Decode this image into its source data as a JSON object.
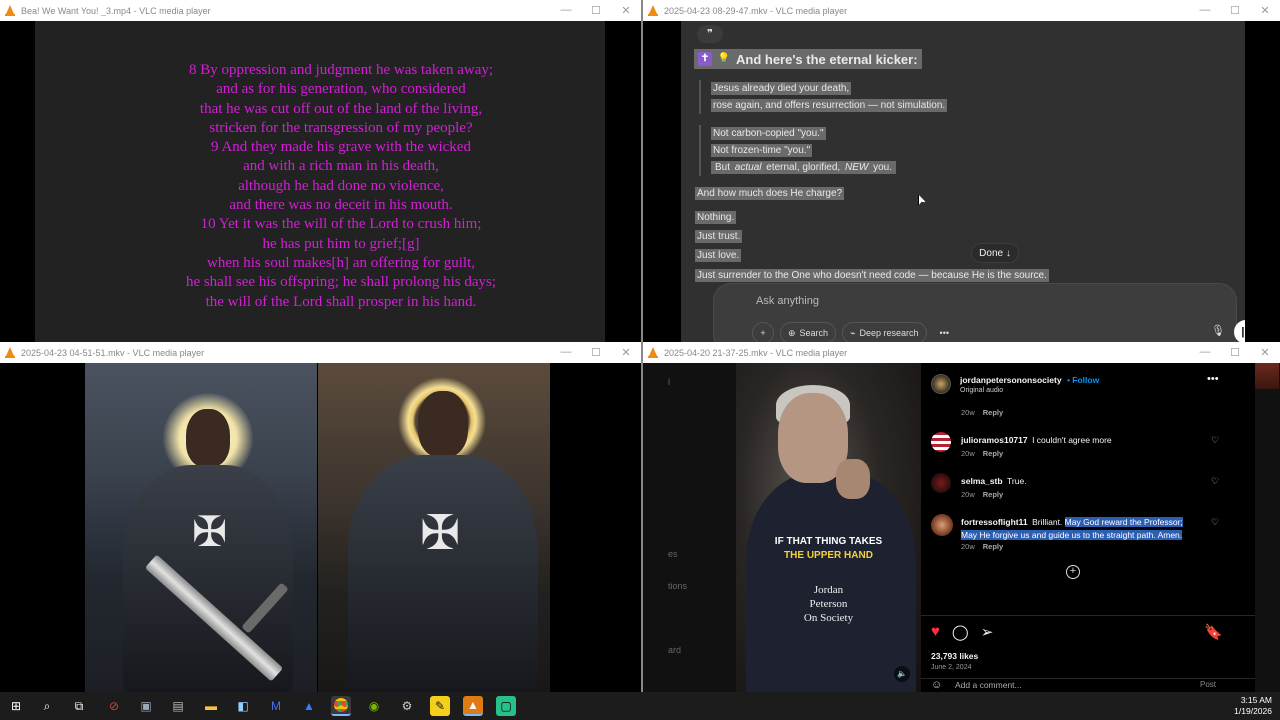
{
  "windows": {
    "w1": {
      "title": "Bea! We Want You! _3.mp4 - VLC media player",
      "verses": [
        "8 By oppression and judgment he was taken away;",
        "and as for his generation, who considered",
        "that he was cut off out of the land of the living,",
        "stricken for the transgression of my people?",
        "9 And they made his grave with the wicked",
        "and with a rich man in his death,",
        "although he had done no violence,",
        "and there was no deceit in his mouth.",
        "10 Yet it was the will of the Lord to crush him;",
        "he has put him to grief;[g]",
        "when his soul makes[h] an offering for guilt,",
        "he shall see his offspring; he shall prolong his days;",
        "the will of the Lord shall prosper in his hand."
      ]
    },
    "w2": {
      "title": "2025-04-23 08-29-47.mkv - VLC media player",
      "quote_icon": "❞",
      "heading": "And here's the eternal kicker:",
      "block1": [
        "Jesus already died your death,",
        "rose again, and offers resurrection — not simulation."
      ],
      "block2_line1": "Not carbon-copied \"you.\"",
      "block2_line2": "Not frozen-time \"you.\"",
      "block2_line3_pre": "But ",
      "block2_line3_em1": "actual",
      "block2_line3_mid": " eternal, glorified, ",
      "block2_line3_em2": "NEW",
      "block2_line3_post": " you.",
      "question": "And how much does He charge?",
      "answers": [
        "Nothing.",
        "Just trust.",
        "Just love.",
        "Just surrender to the One who doesn't need code — because He is the source."
      ],
      "done_label": "Done ↓",
      "composer_placeholder": "Ask anything",
      "tool_search": "Search",
      "tool_deep": "Deep research"
    },
    "w3": {
      "title": "2025-04-23 04-51-51.mkv - VLC media player"
    },
    "w4": {
      "title": "2025-04-20 21-37-25.mkv - VLC media player",
      "left_fragments": [
        "l",
        "es",
        "tions",
        "ard"
      ],
      "caption_top": "IF THAT THING TAKES",
      "caption_bottom": "THE UPPER HAND",
      "brand": [
        "Jordan",
        "Peterson",
        "On Society"
      ],
      "account": "jordanpetersononsociety",
      "follow": "Follow",
      "audio": "Original audio",
      "first_meta_time": "20w",
      "reply": "Reply",
      "comments": [
        {
          "user": "julioramos10717",
          "text": "I couldn't agree more",
          "time": "20w"
        },
        {
          "user": "selma_stb",
          "text": "True.",
          "time": "20w"
        },
        {
          "user": "fortressoflight11",
          "text_plain": "Brilliant. ",
          "text_selected": "May God reward the Professor; May He forgive us and guide us to the straight path. Amen.",
          "time": "20w"
        }
      ],
      "likes": "23,793 likes",
      "date": "June 2, 2024",
      "add_comment": "Add a comment...",
      "post": "Post"
    }
  },
  "taskbar": {
    "time": "3:15 AM",
    "date": "1/19/2026"
  },
  "colors": {
    "scripture_text": "#d41ed8",
    "selection": "#2c5fb3",
    "like_red": "#ff3040"
  }
}
